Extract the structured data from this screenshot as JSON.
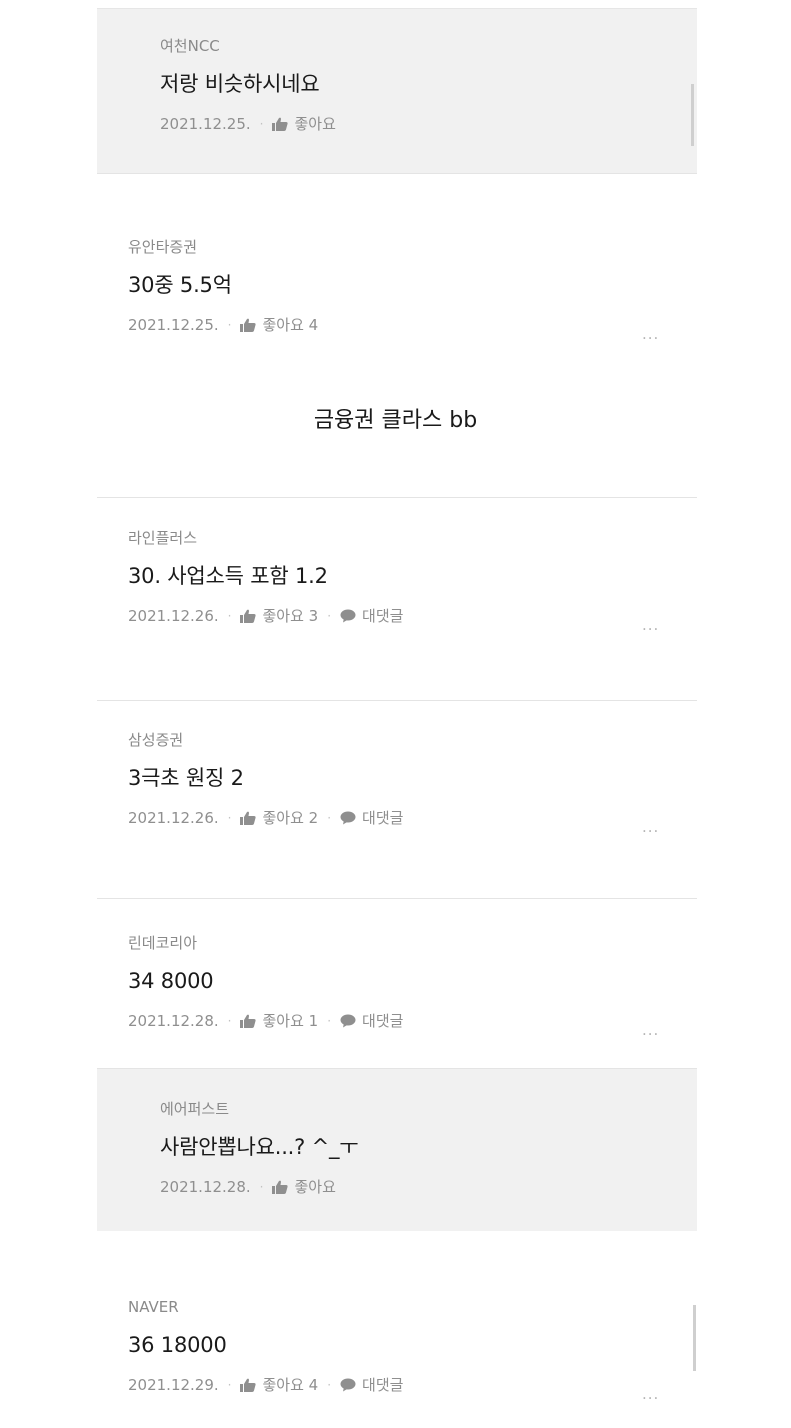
{
  "separator_caption": "금융권 클라스 bb",
  "comments": [
    {
      "author": "여천NCC",
      "body": "저랑 비슷하시네요",
      "date": "2021.12.25.",
      "like_label": "좋아요",
      "reply_label": ""
    },
    {
      "author": "유안타증권",
      "body": "30중 5.5억",
      "date": "2021.12.25.",
      "like_label": "좋아요 4",
      "reply_label": "",
      "more": "..."
    },
    {
      "author": "라인플러스",
      "body": "30. 사업소득 포함 1.2",
      "date": "2021.12.26.",
      "like_label": "좋아요 3",
      "reply_label": "대댓글",
      "more": "..."
    },
    {
      "author": "삼성증권",
      "body": "3극초 원징 2",
      "date": "2021.12.26.",
      "like_label": "좋아요 2",
      "reply_label": "대댓글",
      "more": "..."
    },
    {
      "author": "린데코리아",
      "body": "34 8000",
      "date": "2021.12.28.",
      "like_label": "좋아요 1",
      "reply_label": "대댓글",
      "more": "..."
    },
    {
      "author": "에어퍼스트",
      "body": "사람안뽑나요...? ^_ㅜ",
      "date": "2021.12.28.",
      "like_label": "좋아요",
      "reply_label": ""
    },
    {
      "author": "NAVER",
      "body": "36 18000",
      "date": "2021.12.29.",
      "like_label": "좋아요 4",
      "reply_label": "대댓글",
      "more": "..."
    }
  ],
  "icons": {
    "like": "thumbs-up-icon",
    "reply": "speech-bubble-icon",
    "more": "more-options-icon"
  },
  "colors": {
    "reply_background": "#f1f1f1",
    "text_primary": "#1a1a1a",
    "text_secondary": "#8a8a8a"
  }
}
